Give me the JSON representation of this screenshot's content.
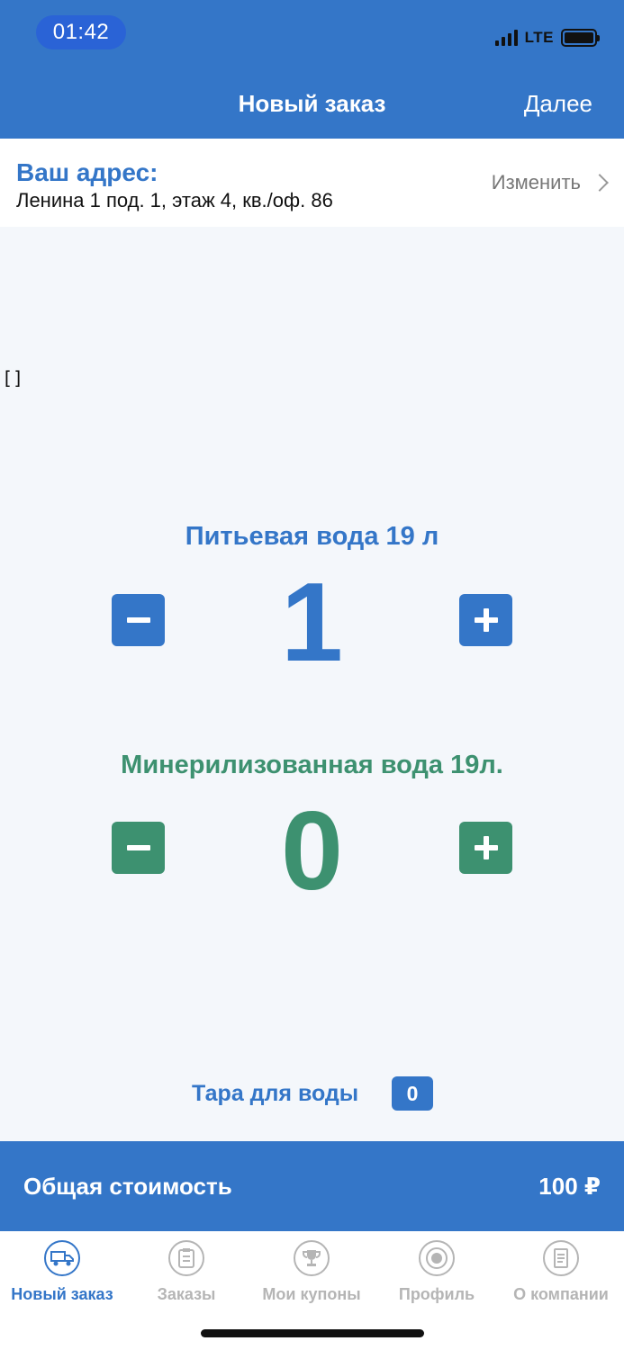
{
  "status": {
    "time": "01:42",
    "network": "LTE"
  },
  "nav": {
    "title": "Новый заказ",
    "next_label": "Далее"
  },
  "address": {
    "label": "Ваш адрес:",
    "value": "Ленина 1 под. 1, этаж 4, кв./оф. 86",
    "change_label": "Изменить"
  },
  "debug_text": "[]",
  "products": [
    {
      "name": "Питьевая вода 19 л",
      "quantity": "1",
      "color": "#3476c8"
    },
    {
      "name": "Минерилизованная вода 19л.",
      "quantity": "0",
      "color": "#3d9170"
    }
  ],
  "tara": {
    "label": "Тара для воды",
    "count": "0"
  },
  "total": {
    "label": "Общая стоимость",
    "value": "100 ₽"
  },
  "tabs": [
    {
      "label": "Новый заказ",
      "icon": "truck-icon",
      "active": true
    },
    {
      "label": "Заказы",
      "icon": "clipboard-icon",
      "active": false
    },
    {
      "label": "Мои купоны",
      "icon": "trophy-icon",
      "active": false
    },
    {
      "label": "Профиль",
      "icon": "profile-emblem-icon",
      "active": false
    },
    {
      "label": "О компании",
      "icon": "document-icon",
      "active": false
    }
  ]
}
